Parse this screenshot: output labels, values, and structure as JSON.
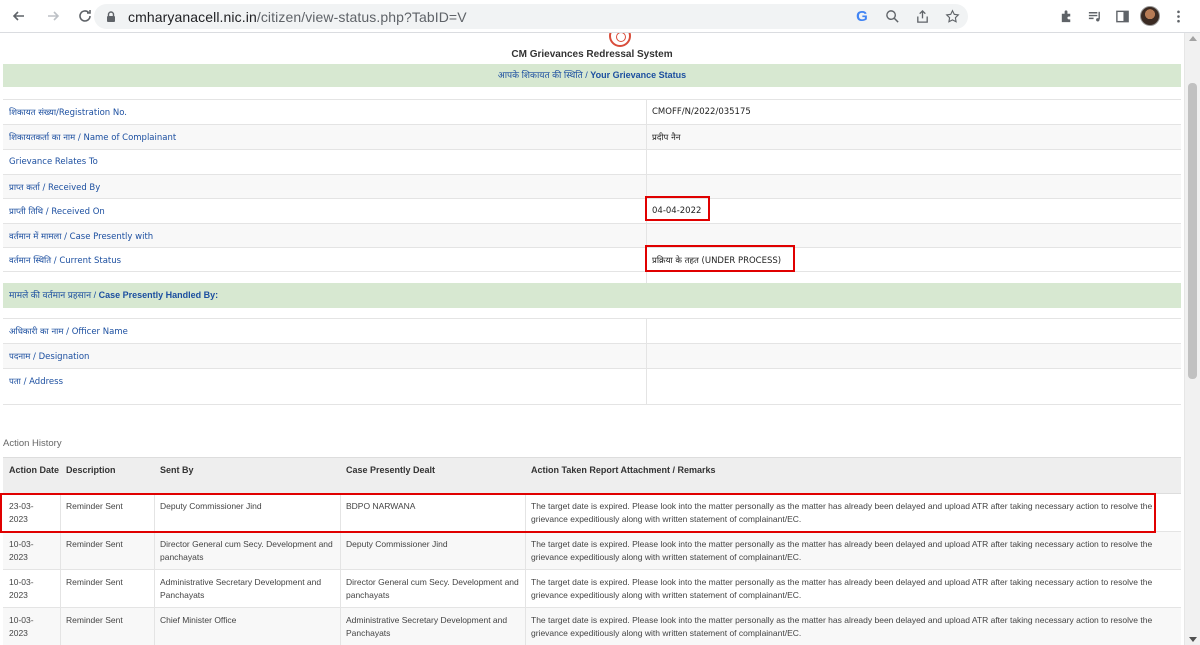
{
  "browser": {
    "url_host": "cmharyanacell.nic.in",
    "url_path": "/citizen/view-status.php?TabID=V",
    "google_badge": "G"
  },
  "page": {
    "site_title": "CM Grievances Redressal System",
    "status_heading_hindi": "आपके शिकायत की स्थिति / ",
    "status_heading_english": "Your Grievance Status",
    "details": [
      {
        "label": "शिकायत संख्या/Registration No.",
        "value": "CMOFF/N/2022/035175"
      },
      {
        "label": "शिकायतकर्ता का नाम / Name of Complainant",
        "value": "प्रदीप नैन"
      },
      {
        "label": "Grievance Relates To",
        "value": ""
      },
      {
        "label": "प्राप्त कर्ता / Received By",
        "value": ""
      },
      {
        "label": "प्राप्ती तिथि / Received On",
        "value": "04-04-2022"
      },
      {
        "label": "वर्तमान में मामला / Case Presently with",
        "value": ""
      },
      {
        "label": "वर्तमान स्थिति / Current Status",
        "value": "प्रक्रिया के तहत (UNDER PROCESS)"
      }
    ],
    "officer_heading_hindi": "मामले की वर्तमान प्रहसान / ",
    "officer_heading_english": "Case Presently Handled By:",
    "officer_details": [
      {
        "label": "अधिकारी का नाम / Officer Name",
        "value": ""
      },
      {
        "label": "पदनाम / Designation",
        "value": ""
      },
      {
        "label": "पता / Address",
        "value": ""
      }
    ],
    "history_title": "Action History",
    "history_columns": [
      "Action Date",
      "Description",
      "Sent By",
      "Case Presently Dealt",
      "Action Taken Report Attachment / Remarks"
    ],
    "history_rows": [
      {
        "date": "23-03-2023",
        "description": "Reminder Sent",
        "sent_by": "Deputy Commissioner Jind",
        "dealt": "BDPO NARWANA",
        "remarks": "The target date is expired. Please look into the matter personally as the matter has already been delayed and upload ATR after taking necessary action to resolve the grievance expeditiously along with written statement of complainant/EC."
      },
      {
        "date": "10-03-2023",
        "description": "Reminder Sent",
        "sent_by": "Director General cum Secy. Development and panchayats",
        "dealt": "Deputy Commissioner Jind",
        "remarks": "The target date is expired. Please look into the matter personally as the matter has already been delayed and upload ATR after taking necessary action to resolve the grievance expeditiously along with written statement of complainant/EC."
      },
      {
        "date": "10-03-2023",
        "description": "Reminder Sent",
        "sent_by": "Administrative Secretary Development and Panchayats",
        "dealt": "Director General cum Secy. Development and panchayats",
        "remarks": "The target date is expired. Please look into the matter personally as the matter has already been delayed and upload ATR after taking necessary action to resolve the grievance expeditiously along with written statement of complainant/EC."
      },
      {
        "date": "10-03-2023",
        "description": "Reminder Sent",
        "sent_by": "Chief Minister Office",
        "dealt": "Administrative Secretary Development and Panchayats",
        "remarks": "The target date is expired. Please look into the matter personally as the matter has already been delayed and upload ATR after taking necessary action to resolve the grievance expeditiously along with written statement of complainant/EC."
      }
    ]
  },
  "colors": {
    "accent_text": "#1c4fa0",
    "band_green": "#d7e8d1",
    "highlight_red": "#e00000"
  }
}
